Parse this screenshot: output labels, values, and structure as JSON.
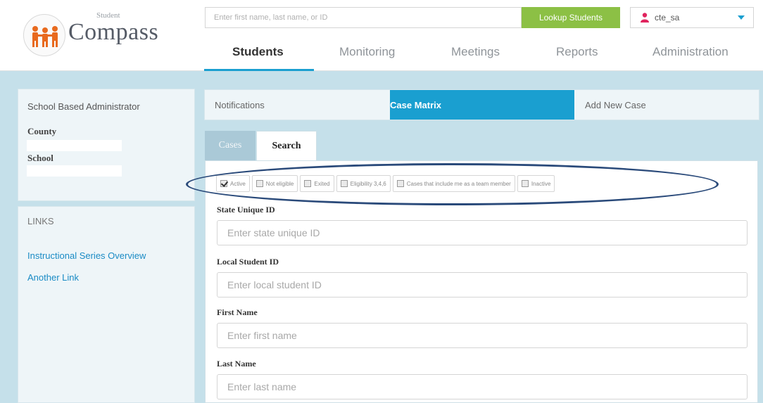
{
  "logo": {
    "small_text": "Student",
    "big_text": "Compass"
  },
  "header": {
    "search_placeholder": "Enter first name, last name, or ID",
    "lookup_label": "Lookup Students",
    "username": "cte_sa",
    "accent_color": "#1a9fd0",
    "lookup_color": "#8cc045"
  },
  "nav": {
    "items": [
      {
        "label": "Students"
      },
      {
        "label": "Monitoring"
      },
      {
        "label": "Meetings"
      },
      {
        "label": "Reports"
      },
      {
        "label": "Administration"
      }
    ]
  },
  "sidebar": {
    "role": "School Based Administrator",
    "county_label": "County",
    "school_label": "School",
    "links_title": "LINKS",
    "links": [
      {
        "label": "Instructional Series Overview"
      },
      {
        "label": "Another Link"
      }
    ]
  },
  "tabs": {
    "items": [
      {
        "label": "Notifications"
      },
      {
        "label": "Case Matrix"
      },
      {
        "label": "Add New Case"
      }
    ]
  },
  "subtabs": {
    "cases_label": "Cases",
    "search_label": "Search"
  },
  "filters": [
    {
      "label": "Active",
      "checked": true
    },
    {
      "label": "Not eligible",
      "checked": false
    },
    {
      "label": "Exited",
      "checked": false
    },
    {
      "label": "Eligibility 3,4,6",
      "checked": false
    },
    {
      "label": "Cases that include me as a team member",
      "checked": false
    },
    {
      "label": "Inactive",
      "checked": false
    }
  ],
  "form": {
    "state_id": {
      "label": "State Unique ID",
      "placeholder": "Enter state unique ID"
    },
    "local_id": {
      "label": "Local Student ID",
      "placeholder": "Enter local student ID"
    },
    "first_name": {
      "label": "First Name",
      "placeholder": "Enter first name"
    },
    "last_name": {
      "label": "Last Name",
      "placeholder": "Enter last name"
    }
  }
}
